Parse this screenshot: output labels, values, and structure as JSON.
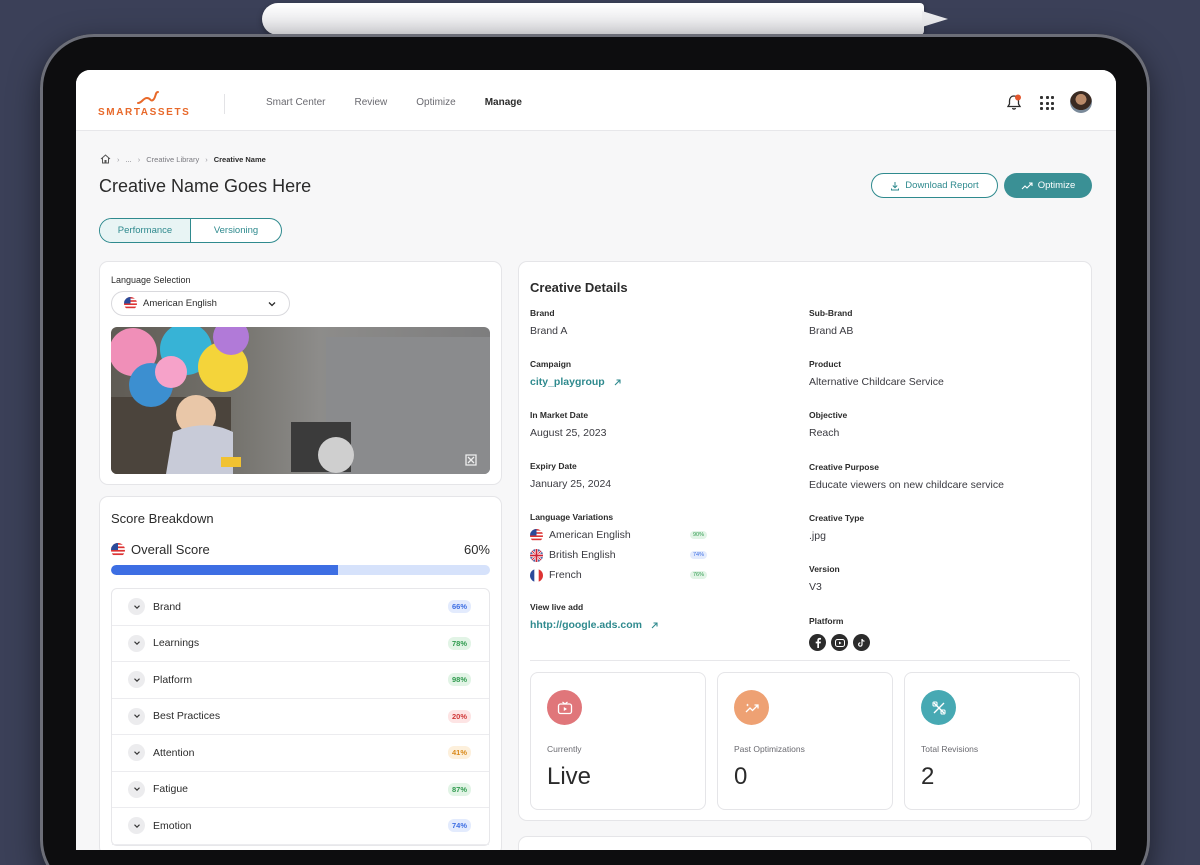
{
  "brand": {
    "name": "SMARTASSETS",
    "color": "#e8692a",
    "accent": "#2f8a8e"
  },
  "nav": {
    "items": [
      {
        "label": "Smart Center",
        "active": false
      },
      {
        "label": "Review",
        "active": false
      },
      {
        "label": "Optimize",
        "active": false
      },
      {
        "label": "Manage",
        "active": true
      }
    ]
  },
  "breadcrumb": {
    "ellipsis": "...",
    "parent": "Creative Library",
    "current": "Creative Name"
  },
  "page": {
    "title": "Creative Name Goes Here",
    "download_label": "Download Report",
    "optimize_label": "Optimize"
  },
  "tabs": [
    {
      "label": "Performance",
      "active": true
    },
    {
      "label": "Versioning",
      "active": false
    }
  ],
  "language": {
    "label": "Language Selection",
    "selected": "American English"
  },
  "score": {
    "title": "Score Breakdown",
    "overall_label": "Overall Score",
    "overall_value": "60%",
    "overall_fraction": 0.6,
    "rows": [
      {
        "label": "Brand",
        "value": "66%",
        "tone": "blue"
      },
      {
        "label": "Learnings",
        "value": "78%",
        "tone": "green"
      },
      {
        "label": "Platform",
        "value": "98%",
        "tone": "green"
      },
      {
        "label": "Best Practices",
        "value": "20%",
        "tone": "red"
      },
      {
        "label": "Attention",
        "value": "41%",
        "tone": "orange"
      },
      {
        "label": "Fatigue",
        "value": "87%",
        "tone": "green"
      },
      {
        "label": "Emotion",
        "value": "74%",
        "tone": "blue"
      }
    ]
  },
  "details": {
    "title": "Creative Details",
    "brand_k": "Brand",
    "brand_v": "Brand A",
    "subbrand_k": "Sub-Brand",
    "subbrand_v": "Brand AB",
    "campaign_k": "Campaign",
    "campaign_v": "city_playgroup",
    "product_k": "Product",
    "product_v": "Alternative Childcare Service",
    "market_k": "In Market Date",
    "market_v": "August 25, 2023",
    "objective_k": "Objective",
    "objective_v": "Reach",
    "expiry_k": "Expiry Date",
    "expiry_v": "January 25, 2024",
    "purpose_k": "Creative Purpose",
    "purpose_v": "Educate viewers on new childcare service",
    "langvar_k": "Language Variations",
    "langvars": [
      {
        "label": "American English",
        "value": "90%",
        "tone": "green"
      },
      {
        "label": "British English",
        "value": "74%",
        "tone": "blue"
      },
      {
        "label": "French",
        "value": "76%",
        "tone": "green"
      }
    ],
    "type_k": "Creative Type",
    "type_v": ".jpg",
    "version_k": "Version",
    "version_v": "V3",
    "live_k": "View live add",
    "live_v": "hhtp://google.ads.com",
    "platform_k": "Platform"
  },
  "stats": [
    {
      "label": "Currently",
      "value": "Live",
      "color": "#e0767a"
    },
    {
      "label": "Past Optimizations",
      "value": "0",
      "color": "#eea173"
    },
    {
      "label": "Total Revisions",
      "value": "2",
      "color": "#47a9b3"
    }
  ]
}
